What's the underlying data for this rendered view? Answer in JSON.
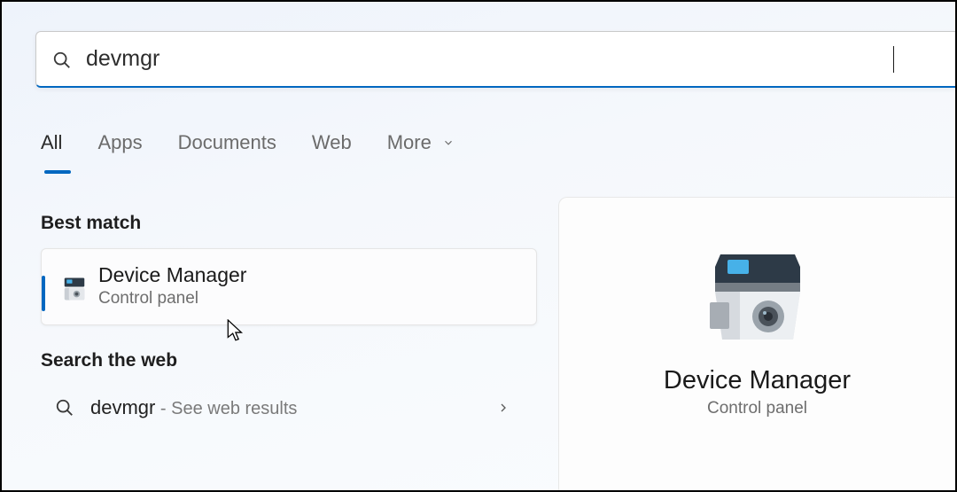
{
  "search": {
    "query": "devmgr"
  },
  "tabs": {
    "all": "All",
    "apps": "Apps",
    "documents": "Documents",
    "web": "Web",
    "more": "More"
  },
  "sections": {
    "best_match": "Best match",
    "search_web": "Search the web"
  },
  "bestMatch": {
    "title": "Device Manager",
    "subtitle": "Control panel"
  },
  "webResult": {
    "term": "devmgr",
    "hint": " - See web results"
  },
  "preview": {
    "title": "Device Manager",
    "subtitle": "Control panel"
  }
}
